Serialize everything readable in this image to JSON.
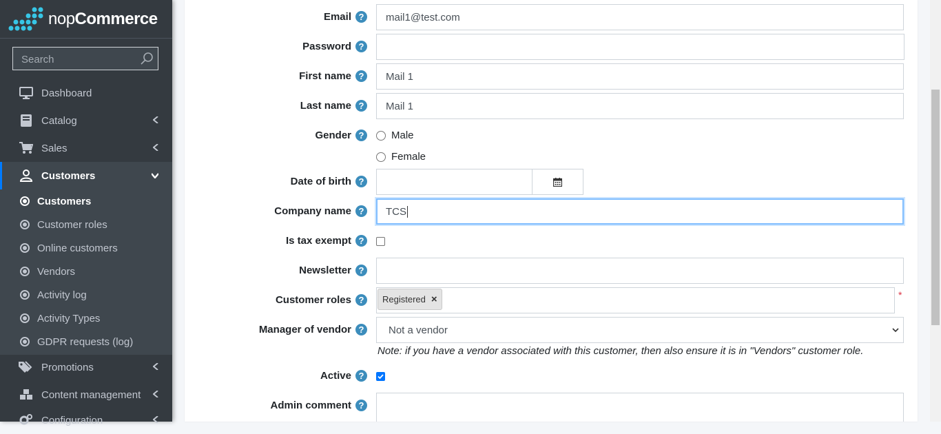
{
  "brand": {
    "name_prefix": "nop",
    "name_suffix": "Commerce"
  },
  "search": {
    "placeholder": "Search"
  },
  "nav": {
    "dashboard": "Dashboard",
    "catalog": "Catalog",
    "sales": "Sales",
    "customers": "Customers",
    "promotions": "Promotions",
    "content_management": "Content management",
    "configuration": "Configuration"
  },
  "subnav": [
    "Customers",
    "Customer roles",
    "Online customers",
    "Vendors",
    "Activity log",
    "Activity Types",
    "GDPR requests (log)"
  ],
  "form": {
    "email_label": "Email",
    "email_value": "mail1@test.com",
    "password_label": "Password",
    "password_value": "",
    "first_name_label": "First name",
    "first_name_value": "Mail 1",
    "last_name_label": "Last name",
    "last_name_value": "Mail 1",
    "gender_label": "Gender",
    "gender_male": "Male",
    "gender_female": "Female",
    "dob_label": "Date of birth",
    "company_label": "Company name",
    "company_value": "TCS",
    "tax_exempt_label": "Is tax exempt",
    "newsletter_label": "Newsletter",
    "roles_label": "Customer roles",
    "role_tag": "Registered",
    "role_remove": "×",
    "required_mark": "*",
    "vendor_label": "Manager of vendor",
    "vendor_value": "Not a vendor",
    "vendor_note": "Note: if you have a vendor associated with this customer, then also ensure it is in \"Vendors\" customer role.",
    "active_label": "Active",
    "active_checked": true,
    "admin_comment_label": "Admin comment"
  },
  "help_glyph": "?"
}
